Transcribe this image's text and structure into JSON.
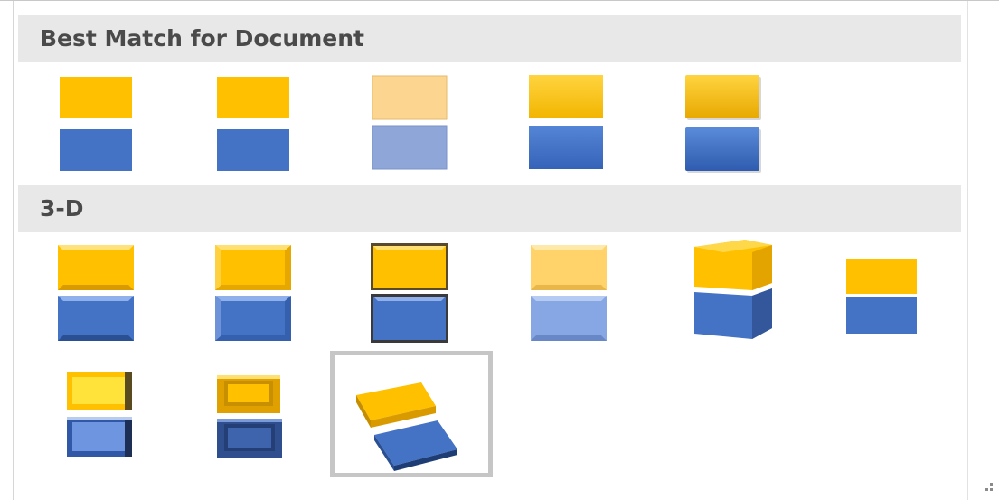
{
  "sections": {
    "best_match": {
      "title": "Best Match for Document"
    },
    "three_d": {
      "title": "3-D"
    }
  },
  "colors": {
    "gold": "#FFC000",
    "blue": "#4472C4",
    "header_bg": "#e8e8e8",
    "header_text": "#4a4a4a",
    "selection_border": "#c6c6c6"
  },
  "swatches": {
    "best_match": [
      {
        "style": "flat"
      },
      {
        "style": "flat"
      },
      {
        "style": "light"
      },
      {
        "style": "gradient"
      },
      {
        "style": "gradient-shadow"
      }
    ],
    "three_d": [
      {
        "style": "bevel"
      },
      {
        "style": "bevel-raised"
      },
      {
        "style": "bevel-outlined"
      },
      {
        "style": "bevel-light"
      },
      {
        "style": "cube"
      },
      {
        "style": "flat-shadow"
      },
      {
        "style": "frame-inset"
      },
      {
        "style": "frame-deep"
      },
      {
        "style": "perspective-tilt",
        "selected": true
      }
    ]
  }
}
